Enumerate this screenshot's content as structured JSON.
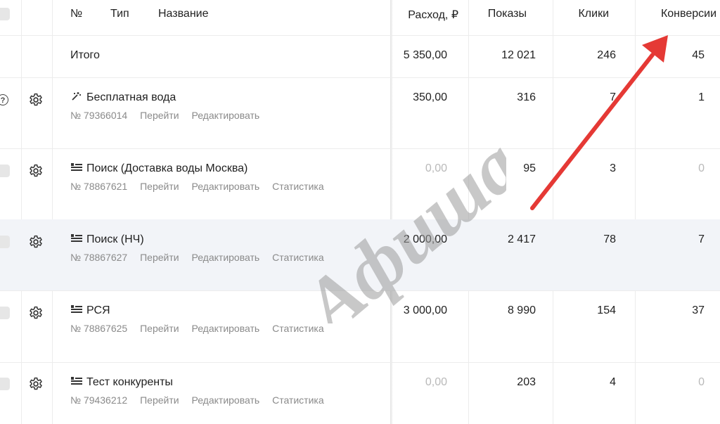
{
  "header": {
    "number": "№",
    "type": "Тип",
    "name": "Название",
    "spend": "Расход, ₽",
    "impressions": "Показы",
    "clicks": "Клики",
    "conversions": "Конверсии"
  },
  "total": {
    "label": "Итого",
    "spend": "5 350,00",
    "impressions": "12 021",
    "clicks": "246",
    "conversions": "45"
  },
  "campaigns": [
    {
      "icon": "magic-wand-icon",
      "name": "Бесплатная вода",
      "number": "№ 79366014",
      "go": "Перейти",
      "edit": "Редактировать",
      "stats": "",
      "spend": "350,00",
      "impressions": "316",
      "clicks": "7",
      "conversions": "1"
    },
    {
      "icon": "list-icon",
      "name": "Поиск (Доставка воды Москва)",
      "number": "№ 78867621",
      "go": "Перейти",
      "edit": "Редактировать",
      "stats": "Статистика",
      "spend": "0,00",
      "impressions": "95",
      "clicks": "3",
      "conversions": "0"
    },
    {
      "icon": "list-icon",
      "name": "Поиск (НЧ)",
      "number": "№ 78867627",
      "go": "Перейти",
      "edit": "Редактировать",
      "stats": "Статистика",
      "spend": "2 000,00",
      "impressions": "2 417",
      "clicks": "78",
      "conversions": "7"
    },
    {
      "icon": "list-icon",
      "name": "РСЯ",
      "number": "№ 78867625",
      "go": "Перейти",
      "edit": "Редактировать",
      "stats": "Статистика",
      "spend": "3 000,00",
      "impressions": "8 990",
      "clicks": "154",
      "conversions": "37"
    },
    {
      "icon": "list-icon",
      "name": "Тест конкуренты",
      "number": "№ 79436212",
      "go": "Перейти",
      "edit": "Редактировать",
      "stats": "Статистика",
      "spend": "0,00",
      "impressions": "203",
      "clicks": "4",
      "conversions": "0"
    }
  ],
  "watermark": "Афиша",
  "colors": {
    "arrow": "#e53935",
    "zero_text": "#b9b9b9",
    "highlight_row": "#f2f4f8",
    "meta_text": "#8a8a8a"
  }
}
